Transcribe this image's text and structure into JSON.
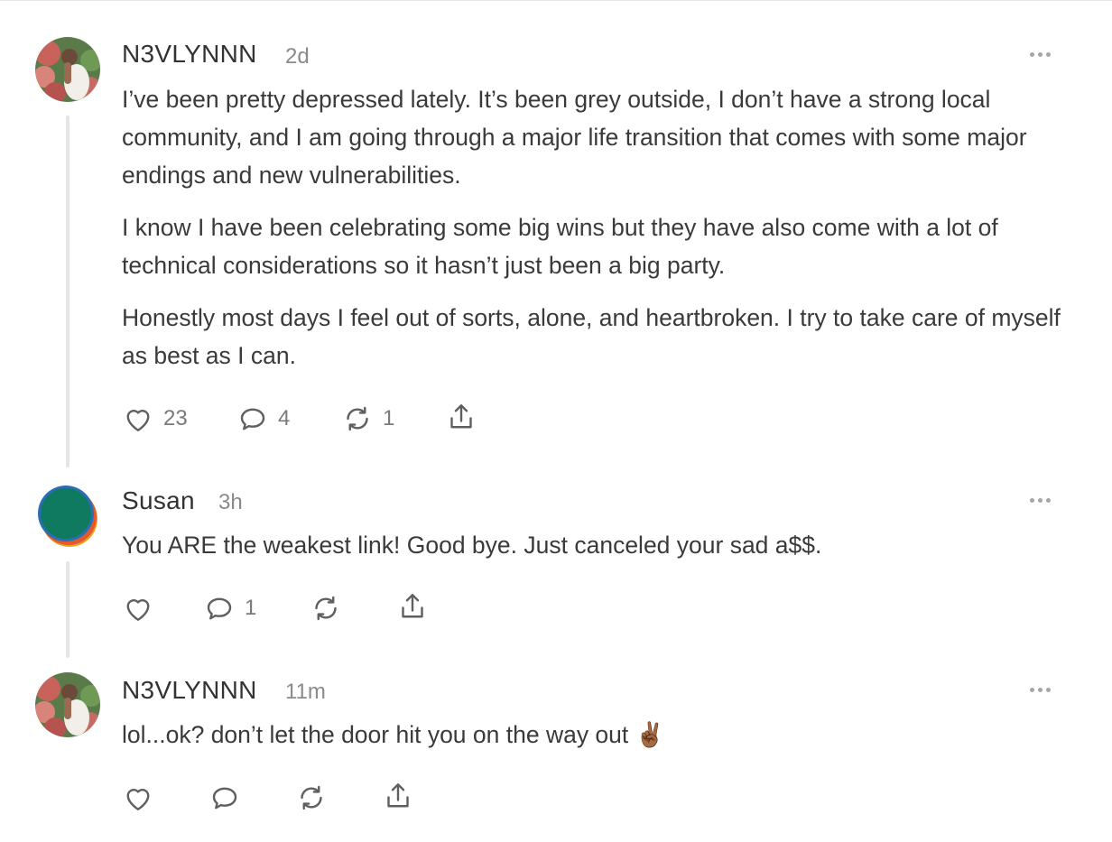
{
  "comments": [
    {
      "author": "N3VLYNNN",
      "time": "2d",
      "avatar_icon": "profile-photo-flowers",
      "paragraphs": [
        "I’ve been pretty depressed lately. It’s been grey outside, I don’t have a strong local community, and I am going through a major life transition that comes with some major endings and new vulnerabilities.",
        "I know I have been celebrating some big wins but they have also come with a lot of technical considerations so it hasn’t just been a big party.",
        "Honestly most days I feel out of sorts, alone, and heartbroken. I try to take care of myself as best as I can."
      ],
      "likes": "23",
      "replies": "4",
      "restacks": "1"
    },
    {
      "author": "Susan",
      "time": "3h",
      "avatar_icon": "teal-circle-avatar",
      "paragraphs": [
        "You ARE the weakest link!  Good bye.  Just canceled your sad a$$."
      ],
      "likes": "",
      "replies": "1",
      "restacks": ""
    },
    {
      "author": "N3VLYNNN",
      "time": "11m",
      "avatar_icon": "profile-photo-flowers",
      "paragraphs": [
        "lol...ok? don’t let the door hit you on the way out ✌🏾"
      ],
      "likes": "",
      "replies": "",
      "restacks": ""
    }
  ],
  "icons": {
    "more": "ellipsis-icon",
    "like": "heart-icon",
    "reply": "comment-bubble-icon",
    "restack": "restack-arrows-icon",
    "share": "share-upload-icon"
  },
  "colors": {
    "text": "#3a3a3a",
    "muted": "#8a8a8a",
    "icon": "#5f5f5f",
    "thread_line": "#e5e5e5"
  }
}
